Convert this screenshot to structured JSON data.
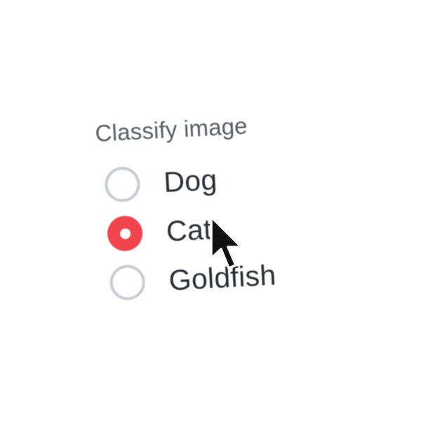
{
  "group": {
    "label": "Classify image",
    "selected": "Cat"
  },
  "options": [
    {
      "label": "Dog",
      "checked": false
    },
    {
      "label": "Cat",
      "checked": true
    },
    {
      "label": "Goldfish",
      "checked": false
    }
  ],
  "colors": {
    "accent": "#f0454d",
    "radio_border": "#c9ccd6",
    "label_text": "#5a5c66",
    "option_text": "#2b2d36"
  },
  "icons": {
    "cursor": "mouse-pointer-icon"
  }
}
